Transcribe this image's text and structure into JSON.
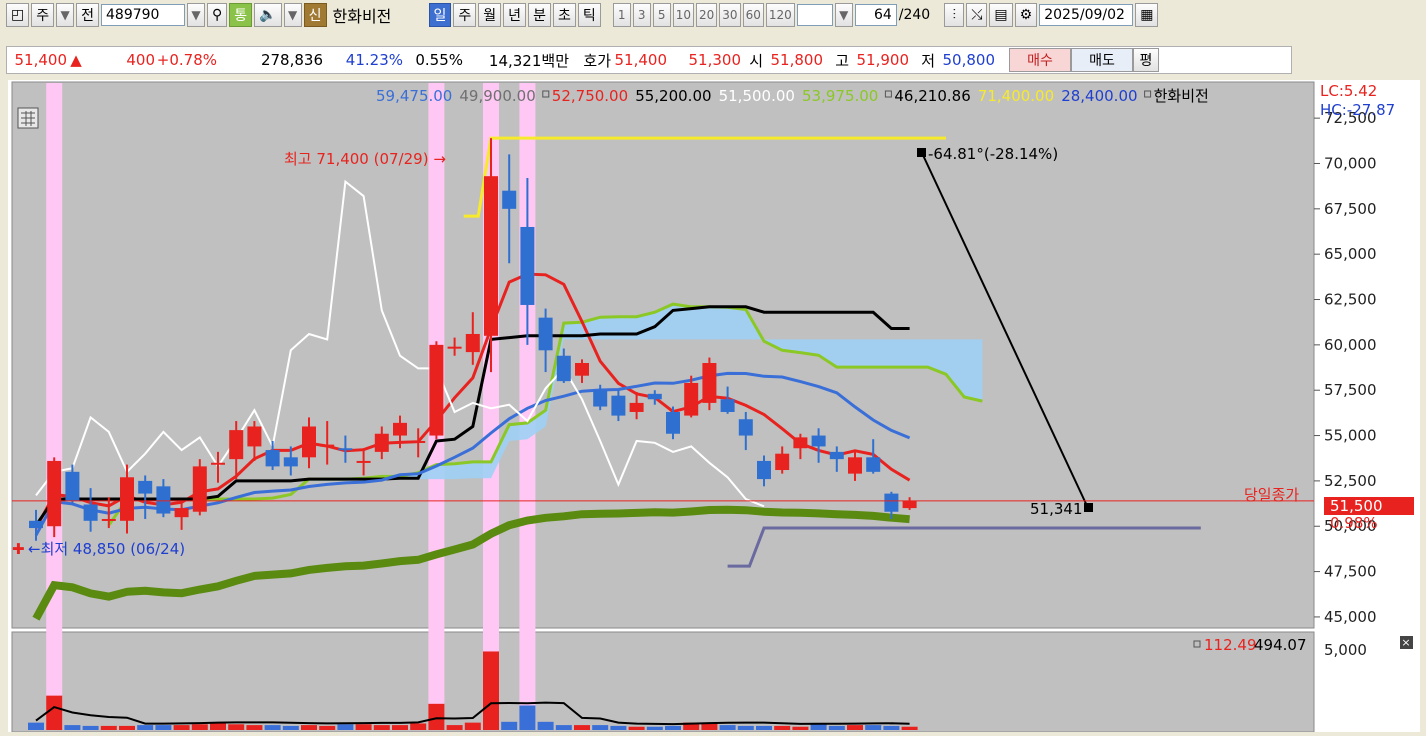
{
  "toolbar": {
    "market_label": "주",
    "prev_label": "전",
    "code": "489790",
    "tong_label": "통",
    "new_badge": "신",
    "stock_name": "한화비전",
    "period_tabs": [
      "일",
      "주",
      "월",
      "년",
      "분",
      "초",
      "틱"
    ],
    "interval_buttons": [
      "1",
      "3",
      "5",
      "10",
      "20",
      "30",
      "60",
      "120"
    ],
    "count_value": "64",
    "count_total": "/240",
    "date_value": "2025/09/02"
  },
  "quote": {
    "price": "51,400",
    "change": "400",
    "change_pct": "+0.78%",
    "volume": "278,836",
    "turnover_pct": "41.23%",
    "ratio_pct": "0.55%",
    "amount": "14,321백만",
    "hoga_label": "호가",
    "ask": "51,400",
    "bid": "51,300",
    "open_label": "시",
    "open": "51,800",
    "high_label": "고",
    "high": "51,900",
    "low_label": "저",
    "low": "50,800",
    "buy_label": "매수",
    "sell_label": "매도",
    "eval_label": "평"
  },
  "legend": {
    "items": [
      {
        "text": "59,475.00",
        "color": "#3a6fd8"
      },
      {
        "text": "49,900.00",
        "color": "#707070"
      },
      {
        "text": "52,750.00",
        "color": "#e8231f"
      },
      {
        "text": "55,200.00",
        "color": "#000000"
      },
      {
        "text": "51,500.00",
        "color": "#ffffff"
      },
      {
        "text": "53,975.00",
        "color": "#8bc825"
      },
      {
        "text": "46,210.86",
        "color": "#000000"
      },
      {
        "text": "71,400.00",
        "color": "#f6ea2a"
      },
      {
        "text": "28,400.00",
        "color": "#1f3fd0"
      },
      {
        "text": "한화비전",
        "color": "#000000"
      }
    ],
    "lc": "LC:5.42",
    "hc": "HC:-27.87"
  },
  "annotations": {
    "max_label": "최고 71,400 (07/29)",
    "min_label": "최저 48,850 (06/24)",
    "trend_label": "-64.81°(-28.14%)",
    "trend_end_value": "51,341",
    "today_close_label": "당일종가",
    "current_price_tag": "51,500",
    "current_pct_tag": "0.98%",
    "volume_legend_1": "112.49",
    "volume_legend_2": "494.07"
  },
  "chart_data": {
    "type": "candlestick",
    "price_axis_ticks": [
      "72,500",
      "70,000",
      "67,500",
      "65,000",
      "62,500",
      "60,000",
      "57,500",
      "55,000",
      "52,500",
      "50,000",
      "47,500",
      "45,000"
    ],
    "ylim": [
      44500,
      73500
    ],
    "volume_axis_ticks": [
      "5,000"
    ],
    "candles": [
      {
        "o": 50300,
        "h": 50900,
        "l": 49200,
        "c": 49900
      },
      {
        "o": 50000,
        "h": 53800,
        "l": 49400,
        "c": 53600
      },
      {
        "o": 53000,
        "h": 53400,
        "l": 51200,
        "c": 51400
      },
      {
        "o": 51200,
        "h": 52100,
        "l": 49700,
        "c": 50300
      },
      {
        "o": 50300,
        "h": 51600,
        "l": 49900,
        "c": 50400
      },
      {
        "o": 50300,
        "h": 53400,
        "l": 49600,
        "c": 52700
      },
      {
        "o": 52500,
        "h": 52800,
        "l": 50400,
        "c": 51800
      },
      {
        "o": 52200,
        "h": 52600,
        "l": 50500,
        "c": 50700
      },
      {
        "o": 50500,
        "h": 51400,
        "l": 49800,
        "c": 51000
      },
      {
        "o": 50800,
        "h": 53700,
        "l": 50600,
        "c": 53300
      },
      {
        "o": 53400,
        "h": 54100,
        "l": 52400,
        "c": 53500
      },
      {
        "o": 53700,
        "h": 55800,
        "l": 52600,
        "c": 55300
      },
      {
        "o": 54400,
        "h": 55800,
        "l": 53600,
        "c": 55500
      },
      {
        "o": 54200,
        "h": 54700,
        "l": 53100,
        "c": 53300
      },
      {
        "o": 53800,
        "h": 54400,
        "l": 52800,
        "c": 53300
      },
      {
        "o": 53800,
        "h": 56000,
        "l": 53200,
        "c": 55500
      },
      {
        "o": 54400,
        "h": 55800,
        "l": 53400,
        "c": 54500
      },
      {
        "o": 54300,
        "h": 55000,
        "l": 53500,
        "c": 54200
      },
      {
        "o": 53500,
        "h": 54300,
        "l": 52800,
        "c": 53600
      },
      {
        "o": 54100,
        "h": 55500,
        "l": 53700,
        "c": 55100
      },
      {
        "o": 55000,
        "h": 56100,
        "l": 54300,
        "c": 55700
      },
      {
        "o": 54600,
        "h": 55400,
        "l": 53800,
        "c": 54700
      },
      {
        "o": 55000,
        "h": 60200,
        "l": 54800,
        "c": 60000
      },
      {
        "o": 59900,
        "h": 60400,
        "l": 59400,
        "c": 59900
      },
      {
        "o": 59600,
        "h": 61800,
        "l": 58900,
        "c": 60600
      },
      {
        "o": 60500,
        "h": 71400,
        "l": 58500,
        "c": 69300
      },
      {
        "o": 68500,
        "h": 70500,
        "l": 64500,
        "c": 67500
      },
      {
        "o": 66500,
        "h": 69200,
        "l": 60000,
        "c": 62200
      },
      {
        "o": 61500,
        "h": 62000,
        "l": 58500,
        "c": 59700
      },
      {
        "o": 59400,
        "h": 59800,
        "l": 57900,
        "c": 58000
      },
      {
        "o": 58300,
        "h": 59200,
        "l": 57900,
        "c": 59000
      },
      {
        "o": 57500,
        "h": 57800,
        "l": 56400,
        "c": 56600
      },
      {
        "o": 57200,
        "h": 57500,
        "l": 55800,
        "c": 56100
      },
      {
        "o": 56300,
        "h": 57400,
        "l": 55900,
        "c": 56800
      },
      {
        "o": 57300,
        "h": 57500,
        "l": 56700,
        "c": 57000
      },
      {
        "o": 56300,
        "h": 56600,
        "l": 54800,
        "c": 55100
      },
      {
        "o": 56100,
        "h": 58300,
        "l": 56000,
        "c": 57900
      },
      {
        "o": 56800,
        "h": 59300,
        "l": 56400,
        "c": 59000
      },
      {
        "o": 57000,
        "h": 57700,
        "l": 56200,
        "c": 56300
      },
      {
        "o": 55900,
        "h": 56300,
        "l": 54200,
        "c": 55000
      },
      {
        "o": 53600,
        "h": 53900,
        "l": 52200,
        "c": 52600
      },
      {
        "o": 53100,
        "h": 54400,
        "l": 52900,
        "c": 54000
      },
      {
        "o": 54300,
        "h": 55100,
        "l": 53700,
        "c": 54900
      },
      {
        "o": 55000,
        "h": 55400,
        "l": 53500,
        "c": 54400
      },
      {
        "o": 54100,
        "h": 54400,
        "l": 53000,
        "c": 53700
      },
      {
        "o": 52900,
        "h": 54200,
        "l": 52500,
        "c": 53800
      },
      {
        "o": 53800,
        "h": 54800,
        "l": 52900,
        "c": 53000
      },
      {
        "o": 51800,
        "h": 51900,
        "l": 50400,
        "c": 50800
      },
      {
        "o": 51000,
        "h": 51600,
        "l": 50900,
        "c": 51400
      }
    ],
    "volume": [
      4.5,
      21,
      3,
      2.5,
      2.5,
      2.5,
      3,
      3,
      3,
      3.5,
      4,
      3.5,
      3,
      3,
      2.5,
      3,
      2.5,
      3.5,
      3.5,
      3,
      3,
      4,
      16,
      3,
      4.5,
      48,
      5,
      15,
      5,
      3,
      3,
      3,
      2.5,
      2,
      2,
      2.5,
      4.5,
      4,
      3,
      2.5,
      2.5,
      2.5,
      2,
      3.5,
      2.5,
      3,
      3,
      2.5,
      2
    ]
  }
}
